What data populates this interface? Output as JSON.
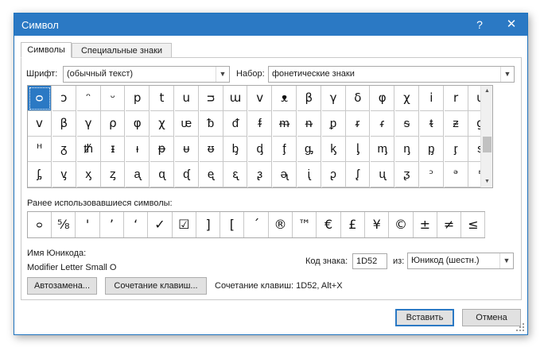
{
  "dialog": {
    "title": "Символ",
    "help_glyph": "?",
    "close_glyph": "✕"
  },
  "tabs": [
    {
      "label": "Символы",
      "active": true
    },
    {
      "label": "Специальные знаки",
      "active": false
    }
  ],
  "font": {
    "label": "Шрифт:",
    "value": "(обычный текст)"
  },
  "subset": {
    "label": "Набор:",
    "value": "фонетические знаки"
  },
  "symbol_grid": {
    "selected_index": 0,
    "rows": [
      [
        "ᴑ",
        "ɔ",
        "ᵔ",
        "ᵕ",
        "p",
        "t",
        "u",
        "ᴝ",
        "ɯ",
        "v",
        "ᴥ",
        "β",
        "γ",
        "δ",
        "φ",
        "χ",
        "i",
        "r",
        "u"
      ],
      [
        "v",
        "β",
        "γ",
        "ρ",
        "φ",
        "χ",
        "ᵫ",
        "ᵬ",
        "ᵭ",
        "ᵮ",
        "ᵯ",
        "ᵰ",
        "ᵱ",
        "ᵲ",
        "ᵳ",
        "ᵴ",
        "ᵵ",
        "ᵶ",
        "ɡ"
      ],
      [
        "ᵸ",
        "ᵹ",
        "ᵺ",
        "ᵻ",
        "ᵼ",
        "ᵽ",
        "ᵾ",
        "ᵿ",
        "ᶀ",
        "ᶁ",
        "ᶂ",
        "ᶃ",
        "ᶄ",
        "ᶅ",
        "ᶆ",
        "ᶇ",
        "ᶈ",
        "ᶉ",
        "ᶊ"
      ],
      [
        "ᶋ",
        "ᶌ",
        "ᶍ",
        "ᶎ",
        "ᶏ",
        "ᶐ",
        "ᶑ",
        "ᶒ",
        "ᶓ",
        "ᶔ",
        "ᶕ",
        "ᶖ",
        "ᶗ",
        "ᶘ",
        "ᶙ",
        "ᶚ",
        "ᵓ",
        "ᵊ",
        "ᵋ"
      ]
    ]
  },
  "recent": {
    "label": "Ранее использовавшиеся символы:",
    "symbols": [
      "ᴑ",
      "⅝",
      "'",
      "’",
      "‘",
      "✓",
      "☑",
      "]",
      "[",
      "´",
      "®",
      "™",
      "€",
      "£",
      "¥",
      "©",
      "±",
      "≠",
      "≤"
    ]
  },
  "unicode_name": {
    "label": "Имя Юникода:",
    "value": "Modifier Letter Small O"
  },
  "char_code": {
    "label": "Код знака:",
    "value": "1D52"
  },
  "from": {
    "label": "из:",
    "value": "Юникод (шестн.)"
  },
  "buttons": {
    "autocorrect": "Автозамена...",
    "shortcut_key": "Сочетание клавиш...",
    "insert": "Вставить",
    "cancel": "Отмена"
  },
  "shortcut_text": "Сочетание клавиш: 1D52, Alt+X",
  "colors": {
    "title_bar": "#2b79c4",
    "selection": "#2b79c4"
  }
}
